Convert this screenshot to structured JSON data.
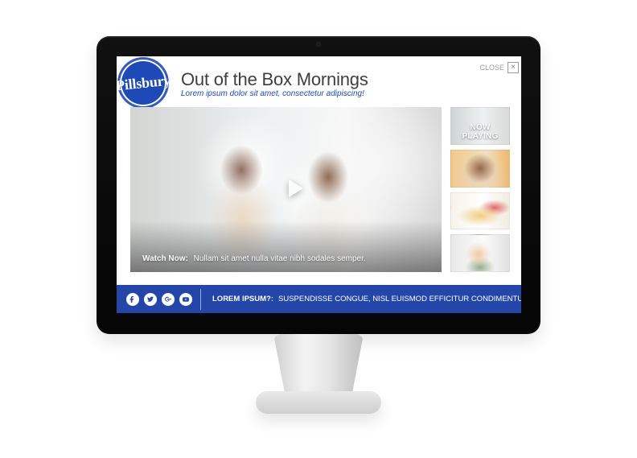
{
  "app": {
    "brand": "Pillsbury",
    "title": "Out of the Box Mornings",
    "subtitle": "Lorem ipsum dolor sit amet, consectetur adipiscing!",
    "close_label": "CLOSE"
  },
  "video": {
    "caption_lead": "Watch Now:",
    "caption_text": "Nullam sit amet nulla vitae nibh sodales semper."
  },
  "thumbnails": {
    "now_playing": "NOW PLAYING",
    "items": [
      {
        "name": "thumbnail-1"
      },
      {
        "name": "thumbnail-2"
      },
      {
        "name": "thumbnail-3"
      },
      {
        "name": "thumbnail-4"
      }
    ]
  },
  "footer": {
    "promo_prefix": "LOREM IPSUM?:",
    "promo_text": "SUSPENDISSE CONGUE, NISL EUISMOD EFFICITUR CONDIMENTUM ANTE!",
    "promo_chevron": ">"
  },
  "icons": {
    "apple": "",
    "close_glyph": "×"
  },
  "colors": {
    "brand_blue": "#1f49b6",
    "bar_blue": "#2346a8"
  }
}
